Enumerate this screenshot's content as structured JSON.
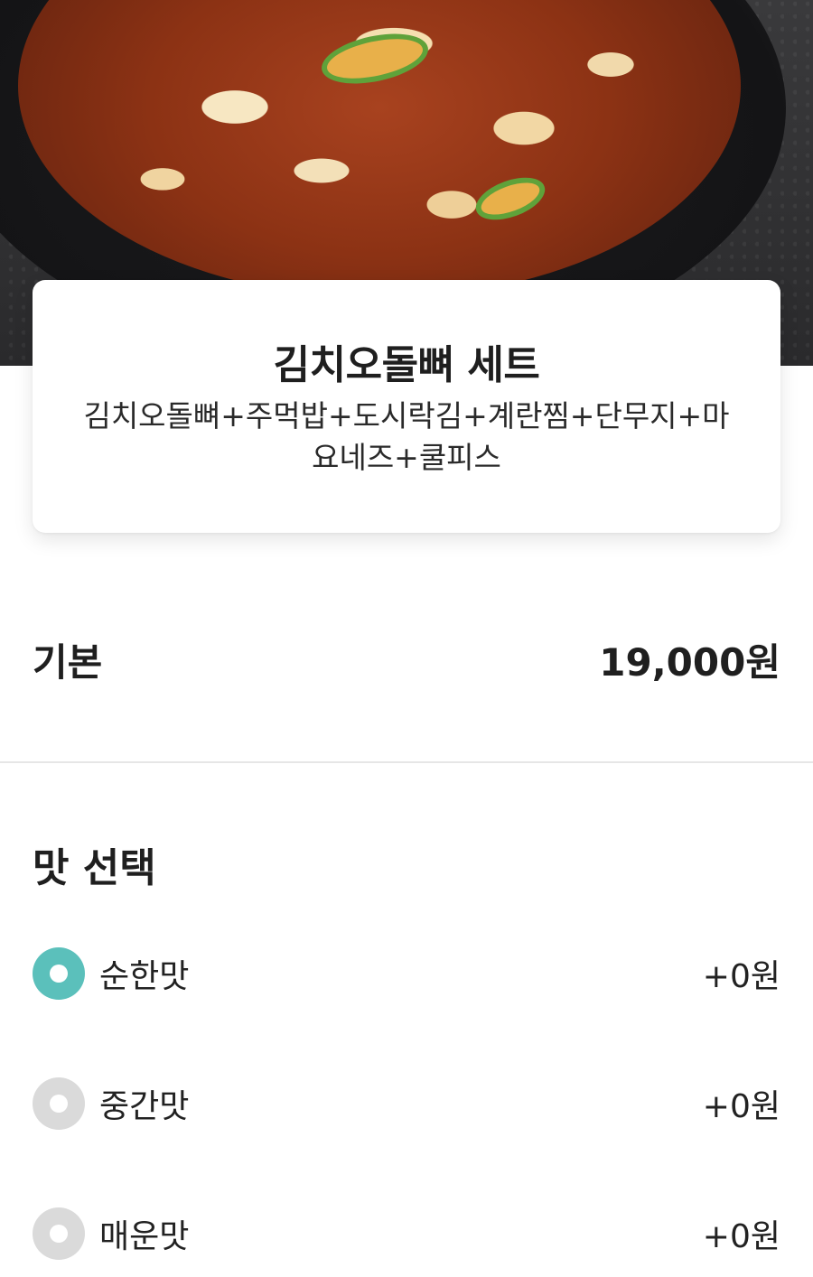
{
  "menu": {
    "name": "김치오돌뼈 세트",
    "description": "김치오돌뼈+주먹밥+도시락김+계란찜+단무지+마요네즈+쿨피스"
  },
  "base": {
    "label": "기본",
    "price": "19,000원"
  },
  "taste_section": {
    "title": "맛 선택",
    "options": [
      {
        "label": "순한맛",
        "price": "+0원",
        "selected": true
      },
      {
        "label": "중간맛",
        "price": "+0원",
        "selected": false
      },
      {
        "label": "매운맛",
        "price": "+0원",
        "selected": false
      }
    ]
  },
  "colors": {
    "accent": "#5bc0bb",
    "radio_unselected": "#dadada",
    "divider": "#e6e6e6"
  }
}
